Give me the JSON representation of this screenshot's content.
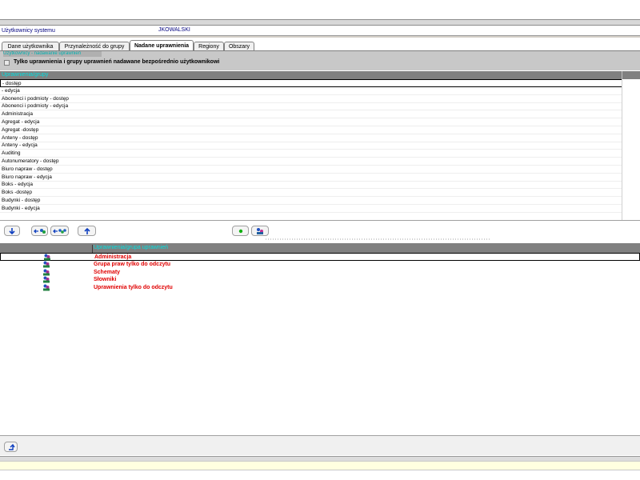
{
  "header": {
    "user_label": "Użytkownicy systemu",
    "user_value": "JKOWALSKI"
  },
  "tabs": [
    {
      "label": "Dane użytkownika",
      "active": false
    },
    {
      "label": "Przynależność do grupy",
      "active": false
    },
    {
      "label": "Nadane uprawnienia",
      "active": true
    },
    {
      "label": "Regiony",
      "active": false
    },
    {
      "label": "Obszary",
      "active": false
    }
  ],
  "panel": {
    "title": "Użytkownicy - nadawanie uprawnień",
    "checkbox_label": "Tylko uprawnienia i grupy uprawnień nadawane bezpośrednio użytkownikowi",
    "checkbox_checked": false
  },
  "permissions_grid": {
    "header": "Uprawnienia/grupy",
    "rows": [
      "- dostęp",
      "- edycja",
      "Abonenci i podmioty - dostęp",
      "Abonenci i podmioty - edycja",
      "Administracja",
      "Agregat - edycja",
      "Agregat -dostęp",
      "Anteny - dostęp",
      "Anteny - edycja",
      "Auditing",
      "Autonumeratory - dostęp",
      "Biuro napraw - dostęp",
      "Biuro napraw - edycja",
      "Boks - edycja",
      "Boks -dostęp",
      "Budynki - dostęp",
      "Budynki - edycja"
    ]
  },
  "toolbar": {
    "icons": [
      "arrow-down-icon",
      "assign-group-icon",
      "assign-all-icon",
      "arrow-up-icon",
      "add-green-icon",
      "users-icon"
    ]
  },
  "assigned_grid": {
    "header": "Uprawnienia/grupa uprawnień",
    "rows": [
      "Administracja",
      "Grupa praw tylko do odczytu",
      "Schematy",
      "Słowniki",
      "Uprawnienia tylko do odczytu"
    ]
  },
  "colors": {
    "accent_header_text": "#00e0e0",
    "assigned_text": "#e00000",
    "header_bg": "#808080"
  }
}
